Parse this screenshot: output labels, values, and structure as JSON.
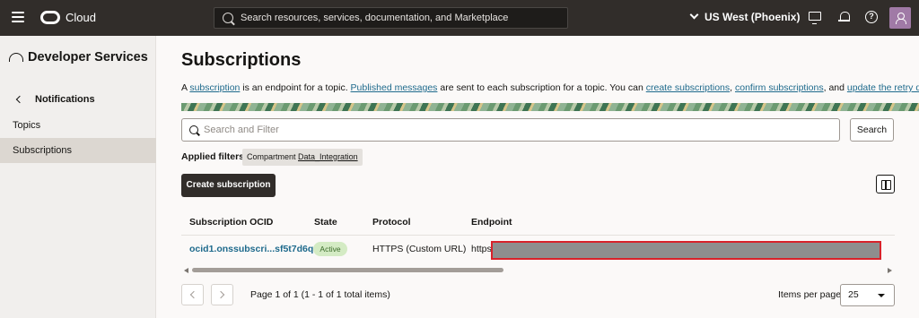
{
  "topbar": {
    "logo_text": "Cloud",
    "search_placeholder": "Search resources, services, documentation, and Marketplace",
    "region": "US West (Phoenix)",
    "help_glyph": "?"
  },
  "sidebar": {
    "service_title": "Developer Services",
    "breadcrumb": "Notifications",
    "items": [
      {
        "label": "Topics",
        "active": false
      },
      {
        "label": "Subscriptions",
        "active": true
      }
    ]
  },
  "page": {
    "title": "Subscriptions",
    "description": {
      "p1": "A ",
      "l1": "subscription",
      "p2": " is an endpoint for a topic. ",
      "l2": "Published messages",
      "p3": " are sent to each subscription for a topic. You can ",
      "l3": "create subscriptions",
      "p4": ", ",
      "l4": "confirm subscriptions",
      "p5": ", and ",
      "l5": "update the retry duration",
      "p6": "."
    }
  },
  "filter": {
    "placeholder": "Search and Filter",
    "search_button": "Search",
    "applied_label": "Applied filters",
    "chip_key": "Compartment ",
    "chip_value": "Data_Integration"
  },
  "actions": {
    "create_button": "Create subscription"
  },
  "table": {
    "columns": [
      "Subscription OCID",
      "State",
      "Protocol",
      "Endpoint"
    ],
    "rows": [
      {
        "ocid": "ocid1.onssubscri...sf5t7d6q",
        "state": "Active",
        "protocol": "HTTPS (Custom URL)",
        "endpoint": "https"
      }
    ]
  },
  "pagination": {
    "info": "Page 1 of 1 (1 - 1 of 1 total items)",
    "items_per_page_label": "Items per page",
    "items_per_page_value": "25"
  },
  "colors": {
    "topbar_bg": "#312d2a",
    "link": "#1e6a8c",
    "active_badge_bg": "#d4ebc4",
    "redaction_border": "#d8222a"
  }
}
